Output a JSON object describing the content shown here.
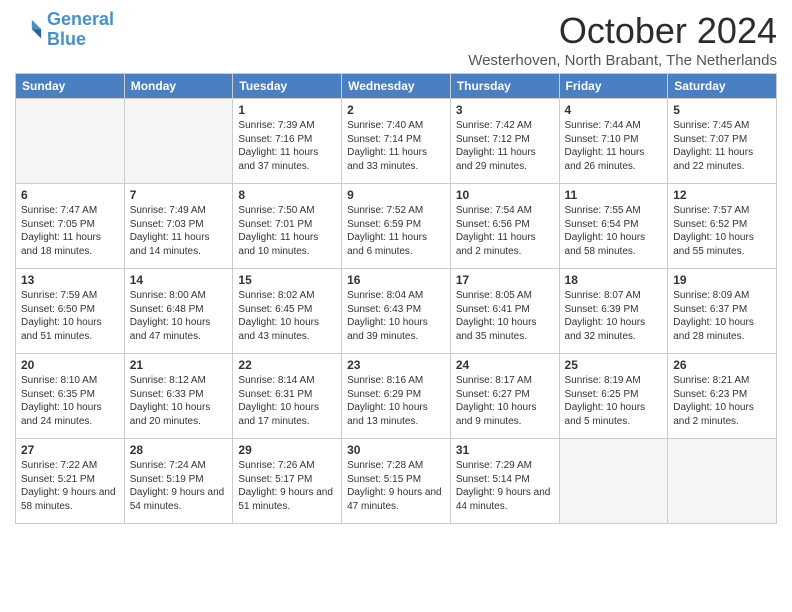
{
  "header": {
    "title": "October 2024",
    "location": "Westerhoven, North Brabant, The Netherlands",
    "logo_line1": "General",
    "logo_line2": "Blue"
  },
  "weekdays": [
    "Sunday",
    "Monday",
    "Tuesday",
    "Wednesday",
    "Thursday",
    "Friday",
    "Saturday"
  ],
  "weeks": [
    [
      {
        "day": "",
        "text": ""
      },
      {
        "day": "",
        "text": ""
      },
      {
        "day": "1",
        "text": "Sunrise: 7:39 AM\nSunset: 7:16 PM\nDaylight: 11 hours and 37 minutes."
      },
      {
        "day": "2",
        "text": "Sunrise: 7:40 AM\nSunset: 7:14 PM\nDaylight: 11 hours and 33 minutes."
      },
      {
        "day": "3",
        "text": "Sunrise: 7:42 AM\nSunset: 7:12 PM\nDaylight: 11 hours and 29 minutes."
      },
      {
        "day": "4",
        "text": "Sunrise: 7:44 AM\nSunset: 7:10 PM\nDaylight: 11 hours and 26 minutes."
      },
      {
        "day": "5",
        "text": "Sunrise: 7:45 AM\nSunset: 7:07 PM\nDaylight: 11 hours and 22 minutes."
      }
    ],
    [
      {
        "day": "6",
        "text": "Sunrise: 7:47 AM\nSunset: 7:05 PM\nDaylight: 11 hours and 18 minutes."
      },
      {
        "day": "7",
        "text": "Sunrise: 7:49 AM\nSunset: 7:03 PM\nDaylight: 11 hours and 14 minutes."
      },
      {
        "day": "8",
        "text": "Sunrise: 7:50 AM\nSunset: 7:01 PM\nDaylight: 11 hours and 10 minutes."
      },
      {
        "day": "9",
        "text": "Sunrise: 7:52 AM\nSunset: 6:59 PM\nDaylight: 11 hours and 6 minutes."
      },
      {
        "day": "10",
        "text": "Sunrise: 7:54 AM\nSunset: 6:56 PM\nDaylight: 11 hours and 2 minutes."
      },
      {
        "day": "11",
        "text": "Sunrise: 7:55 AM\nSunset: 6:54 PM\nDaylight: 10 hours and 58 minutes."
      },
      {
        "day": "12",
        "text": "Sunrise: 7:57 AM\nSunset: 6:52 PM\nDaylight: 10 hours and 55 minutes."
      }
    ],
    [
      {
        "day": "13",
        "text": "Sunrise: 7:59 AM\nSunset: 6:50 PM\nDaylight: 10 hours and 51 minutes."
      },
      {
        "day": "14",
        "text": "Sunrise: 8:00 AM\nSunset: 6:48 PM\nDaylight: 10 hours and 47 minutes."
      },
      {
        "day": "15",
        "text": "Sunrise: 8:02 AM\nSunset: 6:45 PM\nDaylight: 10 hours and 43 minutes."
      },
      {
        "day": "16",
        "text": "Sunrise: 8:04 AM\nSunset: 6:43 PM\nDaylight: 10 hours and 39 minutes."
      },
      {
        "day": "17",
        "text": "Sunrise: 8:05 AM\nSunset: 6:41 PM\nDaylight: 10 hours and 35 minutes."
      },
      {
        "day": "18",
        "text": "Sunrise: 8:07 AM\nSunset: 6:39 PM\nDaylight: 10 hours and 32 minutes."
      },
      {
        "day": "19",
        "text": "Sunrise: 8:09 AM\nSunset: 6:37 PM\nDaylight: 10 hours and 28 minutes."
      }
    ],
    [
      {
        "day": "20",
        "text": "Sunrise: 8:10 AM\nSunset: 6:35 PM\nDaylight: 10 hours and 24 minutes."
      },
      {
        "day": "21",
        "text": "Sunrise: 8:12 AM\nSunset: 6:33 PM\nDaylight: 10 hours and 20 minutes."
      },
      {
        "day": "22",
        "text": "Sunrise: 8:14 AM\nSunset: 6:31 PM\nDaylight: 10 hours and 17 minutes."
      },
      {
        "day": "23",
        "text": "Sunrise: 8:16 AM\nSunset: 6:29 PM\nDaylight: 10 hours and 13 minutes."
      },
      {
        "day": "24",
        "text": "Sunrise: 8:17 AM\nSunset: 6:27 PM\nDaylight: 10 hours and 9 minutes."
      },
      {
        "day": "25",
        "text": "Sunrise: 8:19 AM\nSunset: 6:25 PM\nDaylight: 10 hours and 5 minutes."
      },
      {
        "day": "26",
        "text": "Sunrise: 8:21 AM\nSunset: 6:23 PM\nDaylight: 10 hours and 2 minutes."
      }
    ],
    [
      {
        "day": "27",
        "text": "Sunrise: 7:22 AM\nSunset: 5:21 PM\nDaylight: 9 hours and 58 minutes."
      },
      {
        "day": "28",
        "text": "Sunrise: 7:24 AM\nSunset: 5:19 PM\nDaylight: 9 hours and 54 minutes."
      },
      {
        "day": "29",
        "text": "Sunrise: 7:26 AM\nSunset: 5:17 PM\nDaylight: 9 hours and 51 minutes."
      },
      {
        "day": "30",
        "text": "Sunrise: 7:28 AM\nSunset: 5:15 PM\nDaylight: 9 hours and 47 minutes."
      },
      {
        "day": "31",
        "text": "Sunrise: 7:29 AM\nSunset: 5:14 PM\nDaylight: 9 hours and 44 minutes."
      },
      {
        "day": "",
        "text": ""
      },
      {
        "day": "",
        "text": ""
      }
    ]
  ]
}
